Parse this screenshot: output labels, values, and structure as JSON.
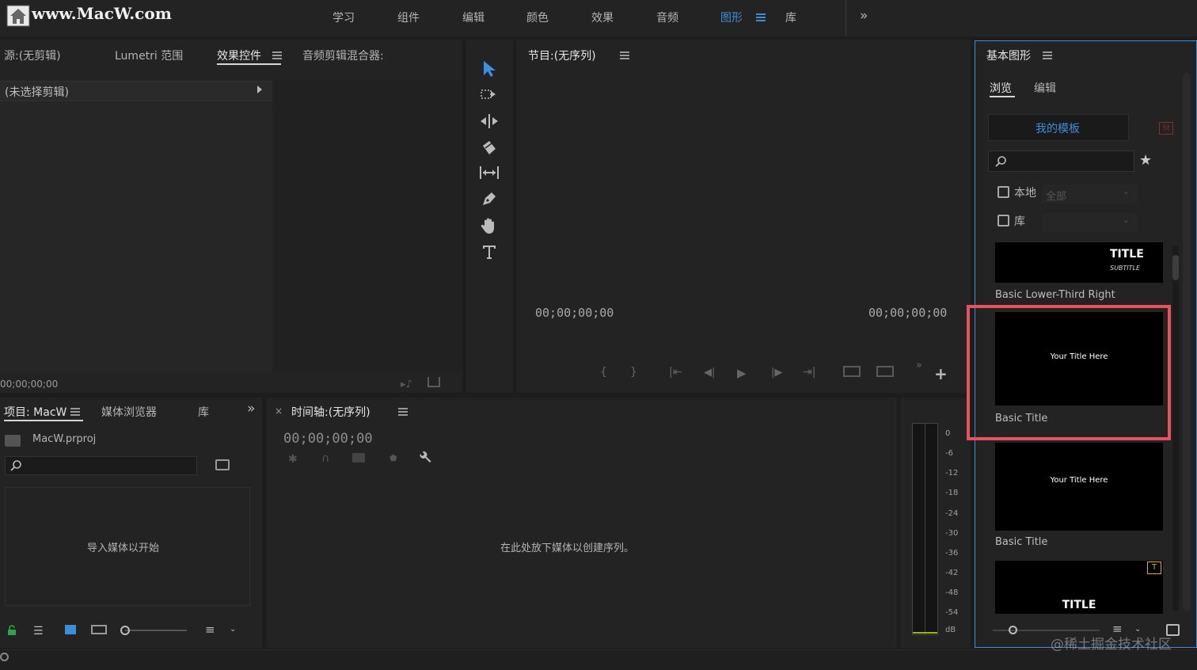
{
  "brand": {
    "logo_text": "www.MacW.com"
  },
  "topbar": {
    "workspaces": [
      "学习",
      "组件",
      "编辑",
      "颜色",
      "效果",
      "音频",
      "图形",
      "库"
    ],
    "active_workspace": "图形",
    "accent": "#3b8ed9"
  },
  "source_panel": {
    "tabs": [
      "源:(无剪辑)",
      "Lumetri 范围",
      "效果控件",
      "音频剪辑混合器:"
    ],
    "active_tab": "效果控件",
    "no_clip": "(未选择剪辑)",
    "timecode": "00;00;00;00"
  },
  "tools": [
    "selection-tool",
    "track-select-tool",
    "ripple-edit-tool",
    "razor-tool",
    "slip-tool",
    "pen-tool",
    "hand-tool",
    "type-tool"
  ],
  "program_panel": {
    "title": "节目:(无序列)",
    "timecode_left": "00;00;00;00",
    "timecode_right": "00;00;00;00"
  },
  "project_panel": {
    "tabs": [
      "项目: MacW",
      "媒体浏览器",
      "库"
    ],
    "active_tab": "项目: MacW",
    "file": "MacW.prproj",
    "import_hint": "导入媒体以开始"
  },
  "timeline_panel": {
    "title": "时间轴:(无序列)",
    "timecode": "00;00;00;00",
    "drop_hint": "在此处放下媒体以创建序列。"
  },
  "audio_meter": {
    "scale": [
      "0",
      "-6",
      "-12",
      "-18",
      "-24",
      "-30",
      "-36",
      "-42",
      "-48",
      "-54",
      "dB"
    ]
  },
  "essential_graphics": {
    "title": "基本图形",
    "tabs": [
      "浏览",
      "编辑"
    ],
    "active_tab": "浏览",
    "my_templates": "我的模板",
    "st_badge": "St",
    "filters": {
      "local_label": "本地",
      "local_value": "全部",
      "library_label": "库",
      "library_value": ""
    },
    "templates": [
      {
        "name": "Basic Lower-Third Right",
        "preview_title": "TITLE",
        "preview_subtitle": "SUBTITLE"
      },
      {
        "name": "Basic Title",
        "preview_text": "Your Title Here",
        "highlighted": true
      },
      {
        "name": "Basic Title",
        "preview_text": "Your Title Here"
      },
      {
        "name": "",
        "preview_title": "TITLE"
      }
    ],
    "highlight_color": "#e8535b"
  },
  "watermark": "@稀土掘金技术社区"
}
